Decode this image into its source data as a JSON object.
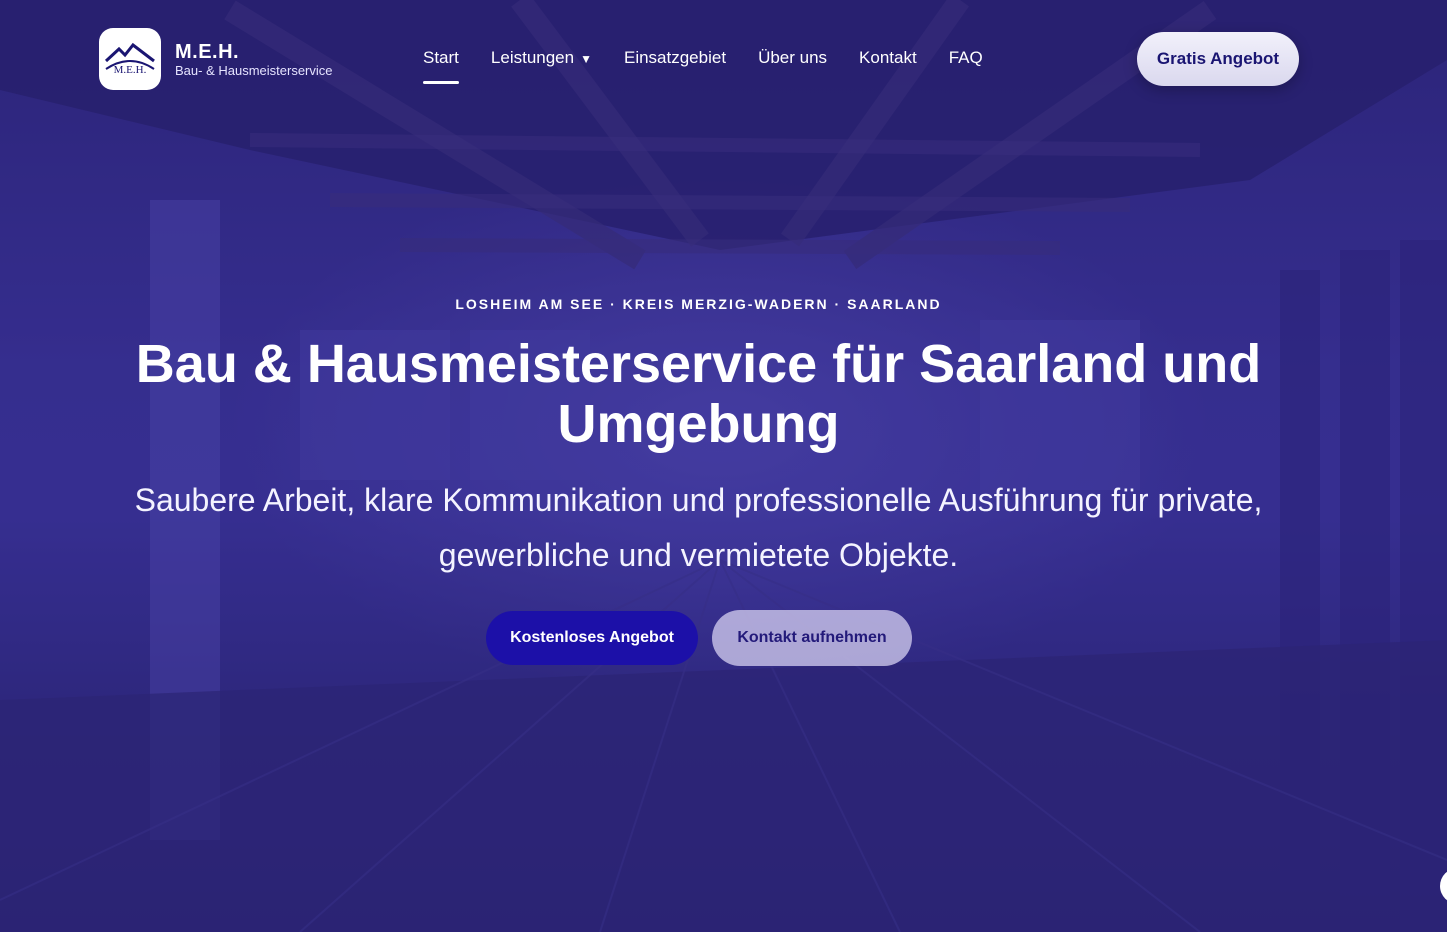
{
  "brand": {
    "name": "M.E.H.",
    "tagline": "Bau- & Hausmeisterservice",
    "logo_text": "M.E.H."
  },
  "nav": {
    "items": [
      {
        "label": "Start",
        "active": true
      },
      {
        "label": "Leistungen",
        "has_dropdown": true
      },
      {
        "label": "Einsatzgebiet"
      },
      {
        "label": "Über uns"
      },
      {
        "label": "Kontakt"
      },
      {
        "label": "FAQ"
      }
    ],
    "dropdown_icon": "chevron-down-icon"
  },
  "header_cta": {
    "label": "Gratis Angebot"
  },
  "hero": {
    "eyebrow": "LOSHEIM AM SEE · KREIS MERZIG-WADERN · SAARLAND",
    "headline": "Bau & Hausmeisterservice für Saarland und Umgebung",
    "subline": "Saubere Arbeit, klare Kommunikation und professionelle Ausführung für private, gewerbliche und vermietete Objekte.",
    "primary_button": "Kostenloses Angebot",
    "secondary_button": "Kontakt aufnehmen"
  },
  "colors": {
    "overlay": "#2e2778",
    "primary_button": "#1c10a8",
    "accent_text": "#1a1572"
  }
}
